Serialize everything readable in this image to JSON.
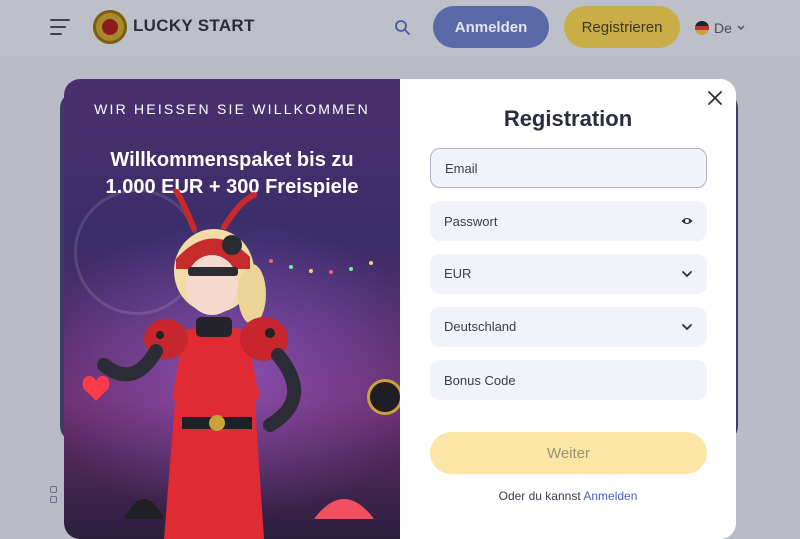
{
  "header": {
    "brand": "LUCKY START",
    "login_label": "Anmelden",
    "register_label": "Registrieren",
    "language": "De",
    "icons": {
      "menu": "menu-icon",
      "search": "search-icon",
      "flag": "german-flag-icon",
      "chevron": "chevron-down-icon",
      "logo": "ladybug-logo-icon"
    }
  },
  "promo": {
    "kicker": "WIR HEISSEN SIE WILLKOMMEN",
    "headline_line1": "Willkommenspaket bis zu",
    "headline_line2": "1.000 EUR + 300 Freispiele"
  },
  "form": {
    "title": "Registration",
    "email_placeholder": "Email",
    "password_placeholder": "Passwort",
    "currency_value": "EUR",
    "country_value": "Deutschland",
    "bonus_placeholder": "Bonus Code",
    "submit_label": "Weiter",
    "footer_text": "Oder du kannst",
    "footer_link": "Anmelden",
    "icons": {
      "close": "close-icon",
      "password_toggle": "eye-icon",
      "select": "chevron-down-icon"
    }
  },
  "colors": {
    "primary_button": "#5a6aa8",
    "register_button": "#c9ae48",
    "submit_button": "#fbe6a8",
    "link": "#4a5ec2"
  }
}
